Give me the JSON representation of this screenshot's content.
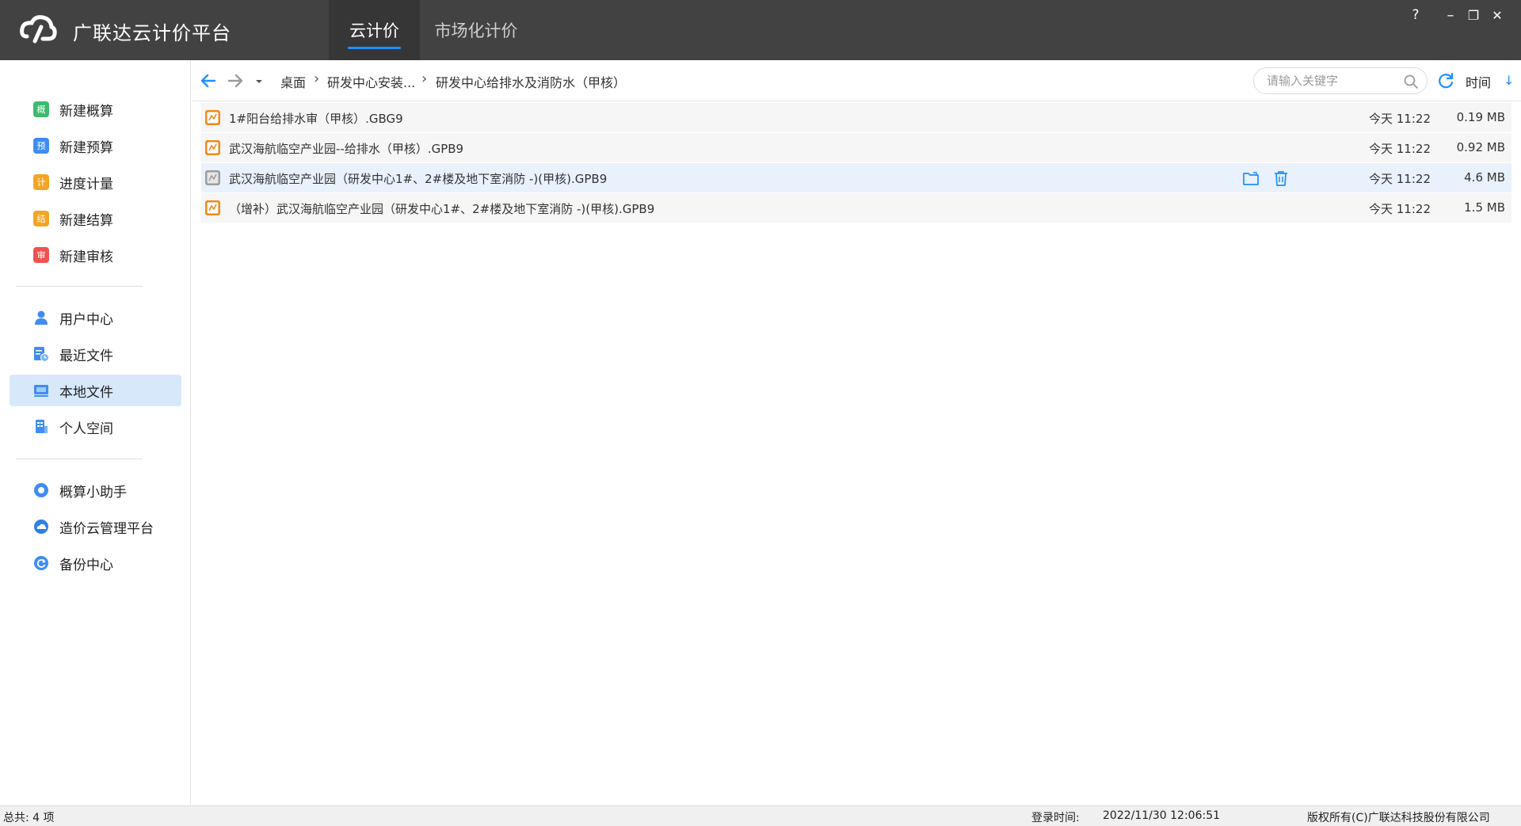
{
  "app": {
    "title": "广联达云计价平台",
    "tabs": [
      {
        "label": "云计价",
        "active": true
      },
      {
        "label": "市场化计价",
        "active": false
      }
    ],
    "window_controls": {
      "help": "?",
      "minimize": "–",
      "restore": "❐",
      "close": "✕"
    },
    "accent_color": "#1f8fff"
  },
  "sidebar": {
    "groups": [
      [
        {
          "label": "新建概算",
          "icon": "gai-icon",
          "glyph": "概",
          "color": "#3dbb6f"
        },
        {
          "label": "新建预算",
          "icon": "yu-icon",
          "glyph": "预",
          "color": "#3f8df2"
        },
        {
          "label": "进度计量",
          "icon": "ji-icon",
          "glyph": "计",
          "color": "#f4a524"
        },
        {
          "label": "新建结算",
          "icon": "jie-icon",
          "glyph": "结",
          "color": "#f4a524"
        },
        {
          "label": "新建审核",
          "icon": "shen-icon",
          "glyph": "审",
          "color": "#ef5350"
        }
      ],
      [
        {
          "label": "用户中心",
          "icon": "user-icon"
        },
        {
          "label": "最近文件",
          "icon": "recent-file-icon"
        },
        {
          "label": "本地文件",
          "icon": "local-file-icon",
          "active": true
        },
        {
          "label": "个人空间",
          "icon": "personal-space-icon"
        }
      ],
      [
        {
          "label": "概算小助手",
          "icon": "assistant-icon"
        },
        {
          "label": "造价云管理平台",
          "icon": "cloud-platform-icon"
        },
        {
          "label": "备份中心",
          "icon": "backup-icon"
        }
      ]
    ]
  },
  "addressbar": {
    "breadcrumb": [
      "桌面",
      "研发中心安装...",
      "研发中心给排水及消防水（甲核）"
    ],
    "search_placeholder": "请输入关键字",
    "sort_label": "时间",
    "sort_arrow": "↓"
  },
  "files": [
    {
      "name": "1#阳台给排水审（甲核）.GBG9",
      "time": "今天 11:22",
      "size": "0.19  MB",
      "icon_color": "#f08a1c"
    },
    {
      "name": "武汉海航临空产业园--给排水（甲核）.GPB9",
      "time": "今天 11:22",
      "size": "0.92  MB",
      "icon_color": "#f08a1c"
    },
    {
      "name": "武汉海航临空产业园（研发中心1#、2#楼及地下室消防 -)(甲核).GPB9",
      "time": "今天 11:22",
      "size": "4.6  MB",
      "icon_color": "#9e9e9e",
      "hover": true
    },
    {
      "name": "（增补）武汉海航临空产业园（研发中心1#、2#楼及地下室消防 -)(甲核).GPB9",
      "time": "今天 11:22",
      "size": "1.5  MB",
      "icon_color": "#f08a1c"
    }
  ],
  "statusbar": {
    "total": "总共: 4 项",
    "login_label": "登录时间:",
    "login_time": "2022/11/30 12:06:51",
    "copyright": "版权所有(C)广联达科技股份有限公司"
  }
}
